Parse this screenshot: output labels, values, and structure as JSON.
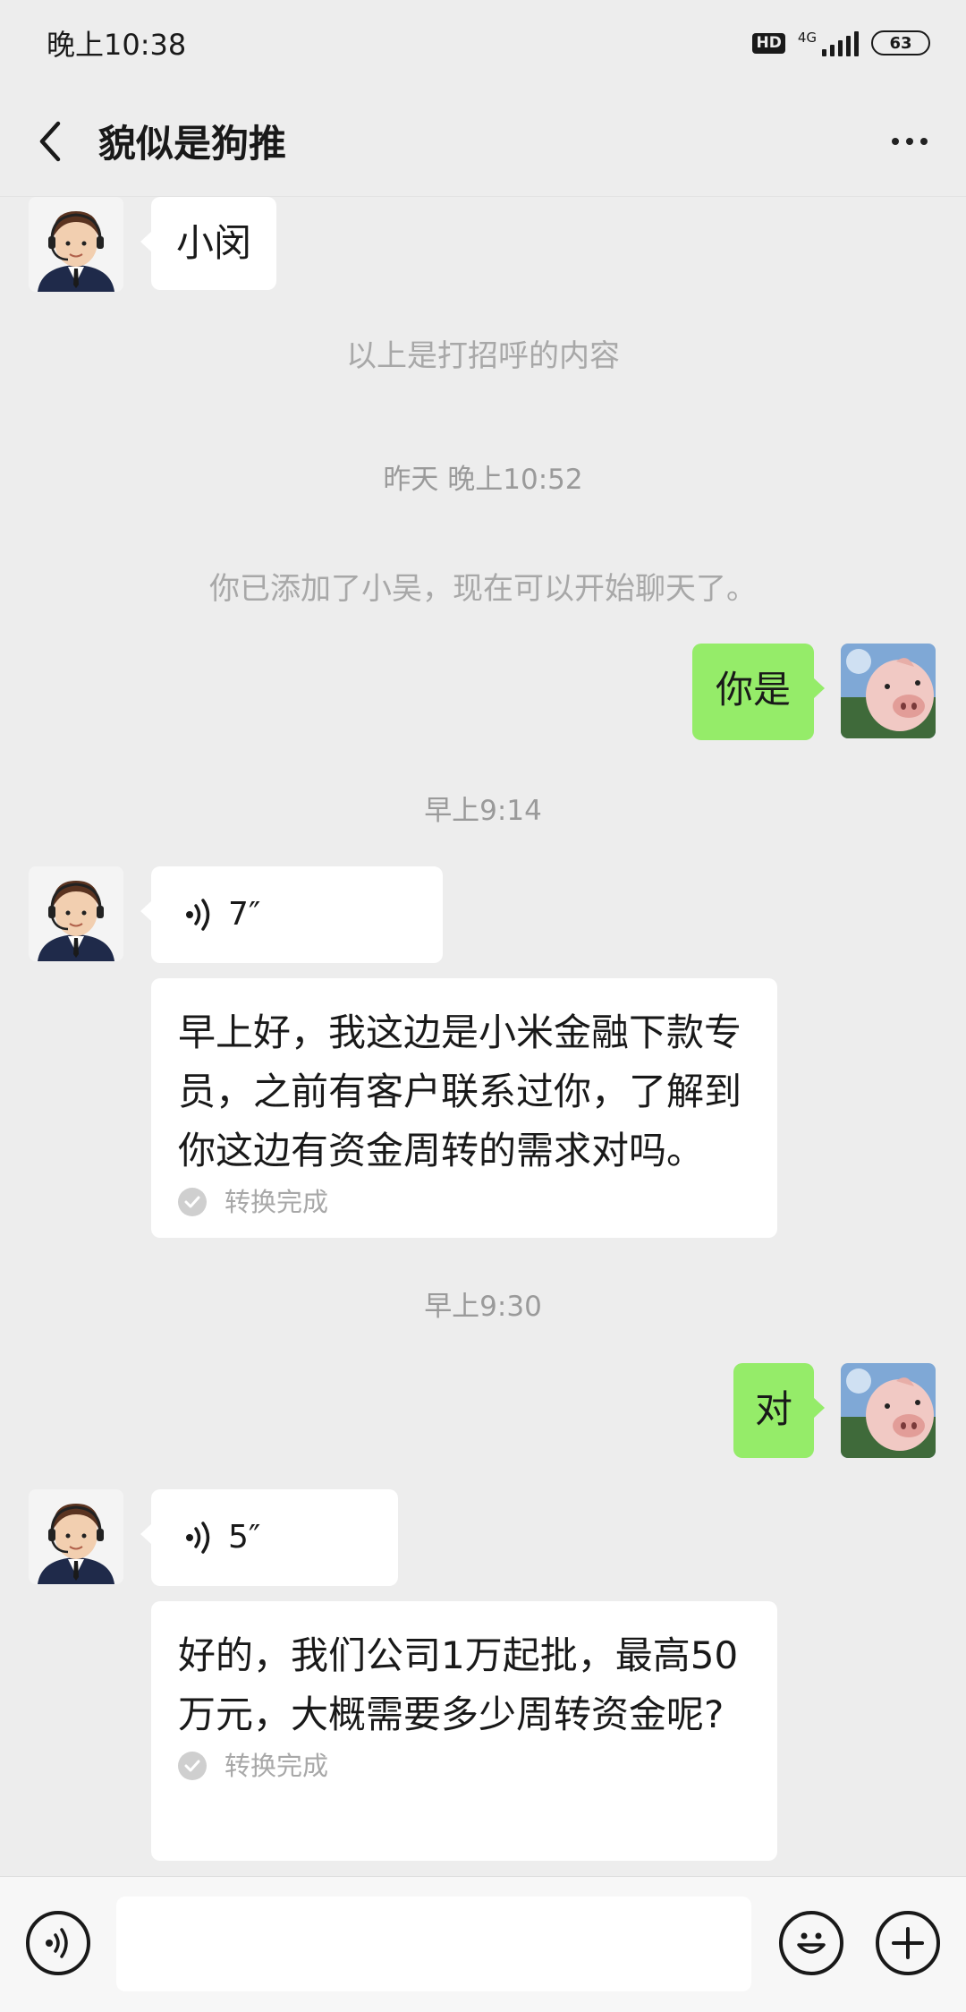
{
  "status_bar": {
    "time": "晚上10:38",
    "hd": "HD",
    "network": "4G",
    "battery": "63"
  },
  "header": {
    "title": "貌似是狗推"
  },
  "messages": {
    "m1_text": "小闵",
    "greeting_note": "以上是打招呼的内容",
    "time1": "昨天 晚上10:52",
    "added_note": "你已添加了小吴，现在可以开始聊天了。",
    "m2_text": "你是",
    "time2": "早上9:14",
    "m3_voice_duration": "7″",
    "m3_transcript": "早上好，我这边是小米金融下款专员，之前有客户联系过你，了解到你这边有资金周转的需求对吗。",
    "m3_status": "转换完成",
    "time3": "早上9:30",
    "m4_text": "对",
    "m5_voice_duration": "5″",
    "m5_transcript": "好的，我们公司1万起批，最高50万元，大概需要多少周转资金呢?",
    "m5_status": "转换完成"
  },
  "input_bar": {
    "value": ""
  },
  "colors": {
    "background": "#ededed",
    "bubble_green": "#95ec69",
    "bubble_white": "#ffffff"
  }
}
